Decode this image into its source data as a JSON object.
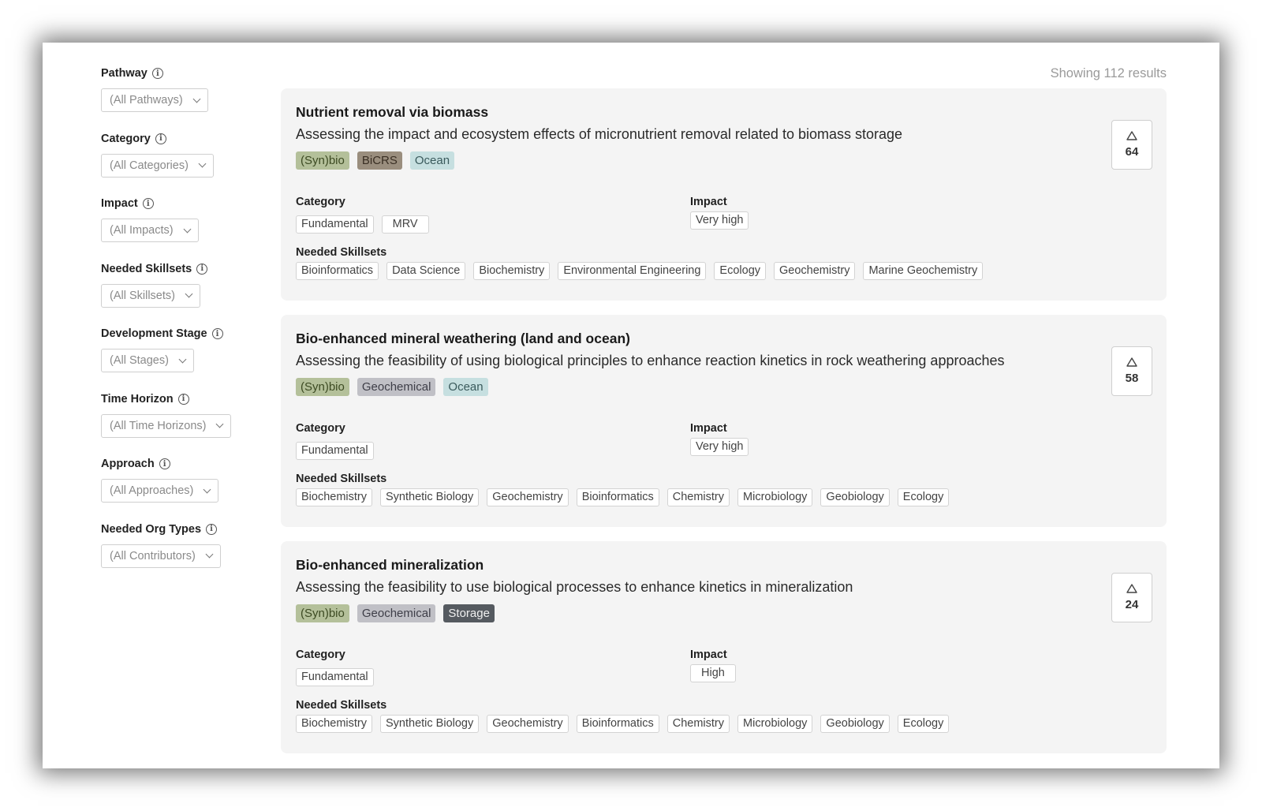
{
  "filters": [
    {
      "label": "Pathway",
      "value": "(All Pathways)"
    },
    {
      "label": "Category",
      "value": "(All Categories)"
    },
    {
      "label": "Impact",
      "value": "(All Impacts)"
    },
    {
      "label": "Needed Skillsets",
      "value": "(All Skillsets)"
    },
    {
      "label": "Development Stage",
      "value": "(All Stages)"
    },
    {
      "label": "Time Horizon",
      "value": "(All Time Horizons)"
    },
    {
      "label": "Approach",
      "value": "(All Approaches)"
    },
    {
      "label": "Needed Org Types",
      "value": "(All Contributors)"
    }
  ],
  "icons": {
    "info": "info-icon",
    "dropdown": "chevron-down-icon",
    "upvote": "triangle-up-icon"
  },
  "results_count": "Showing 112 results",
  "section_labels": {
    "category": "Category",
    "impact": "Impact",
    "skillsets": "Needed Skillsets"
  },
  "results": [
    {
      "title": "Nutrient removal via biomass",
      "description": "Assessing the impact and ecosystem effects of micronutrient removal related to biomass storage",
      "tags": [
        "(Syn)bio",
        "BiCRS",
        "Ocean"
      ],
      "categories": [
        "Fundamental",
        "MRV"
      ],
      "impact": "Very high",
      "skillsets": [
        "Bioinformatics",
        "Data Science",
        "Biochemistry",
        "Environmental Engineering",
        "Ecology",
        "Geochemistry",
        "Marine Geochemistry"
      ],
      "votes": "64"
    },
    {
      "title": "Bio-enhanced mineral weathering (land and ocean)",
      "description": "Assessing the feasibility of using biological principles to enhance reaction kinetics in rock weathering approaches",
      "tags": [
        "(Syn)bio",
        "Geochemical",
        "Ocean"
      ],
      "categories": [
        "Fundamental"
      ],
      "impact": "Very high",
      "skillsets": [
        "Biochemistry",
        "Synthetic Biology",
        "Geochemistry",
        "Bioinformatics",
        "Chemistry",
        "Microbiology",
        "Geobiology",
        "Ecology"
      ],
      "votes": "58"
    },
    {
      "title": "Bio-enhanced mineralization",
      "description": "Assessing the feasibility to use biological processes to enhance kinetics in mineralization",
      "tags": [
        "(Syn)bio",
        "Geochemical",
        "Storage"
      ],
      "categories": [
        "Fundamental"
      ],
      "impact": "High",
      "skillsets": [
        "Biochemistry",
        "Synthetic Biology",
        "Geochemistry",
        "Bioinformatics",
        "Chemistry",
        "Microbiology",
        "Geobiology",
        "Ecology"
      ],
      "votes": "24"
    }
  ],
  "tag_colors": {
    "(Syn)bio": "#b4c09a",
    "BiCRS": "#9a8e7e",
    "Ocean": "#c6dfe0",
    "Geochemical": "#c0c0c6",
    "Storage": "#555a60"
  }
}
